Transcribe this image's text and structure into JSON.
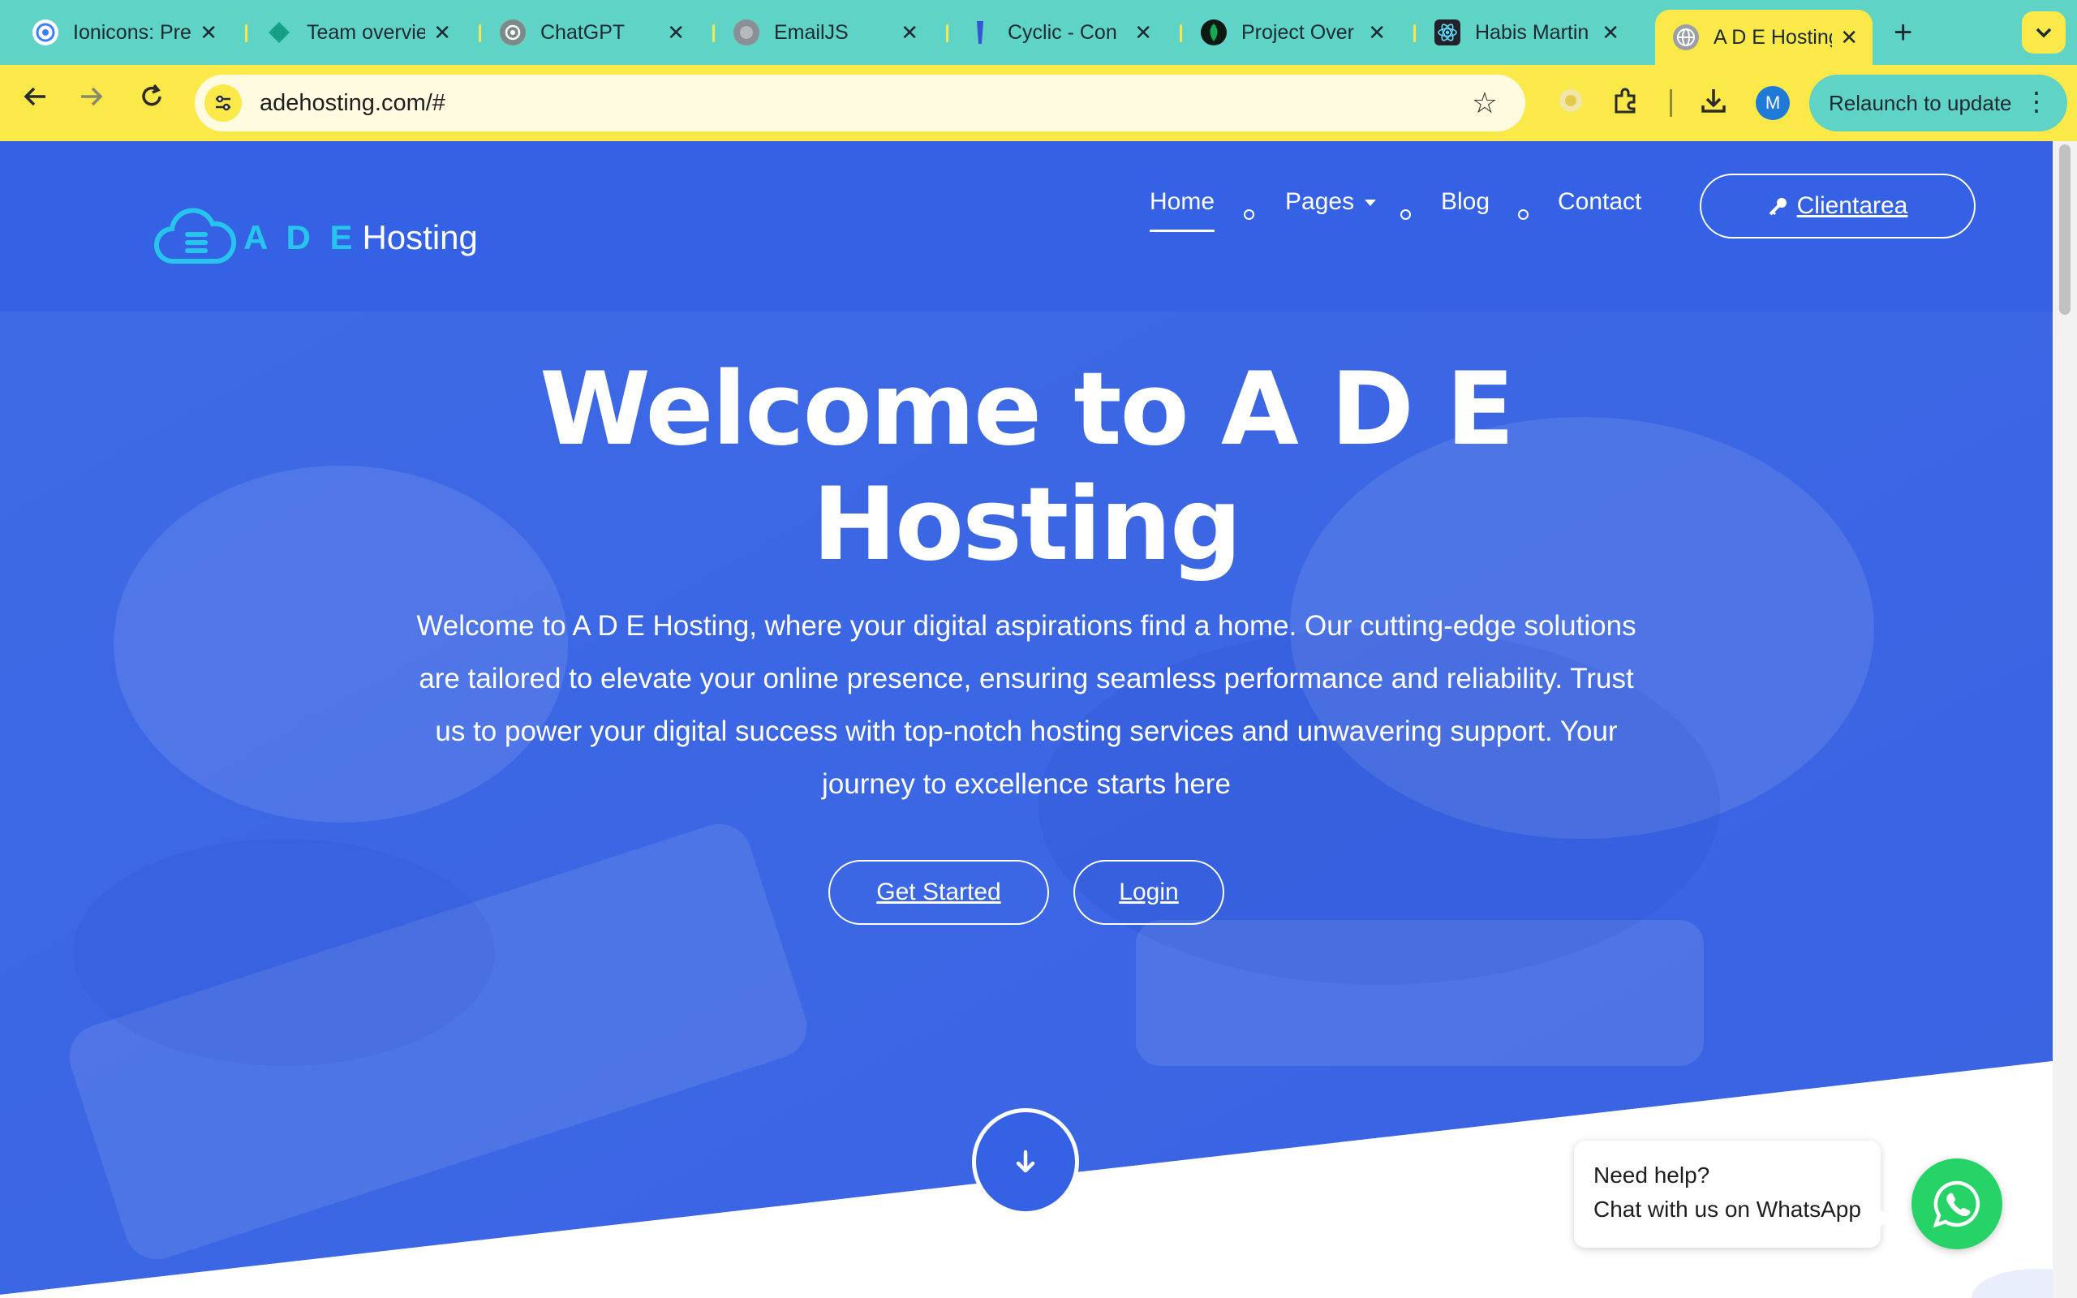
{
  "browser": {
    "tabs": [
      {
        "title": "Ionicons: Pre",
        "icon": "ionicons-icon"
      },
      {
        "title": "Team overvie",
        "icon": "diamond-icon"
      },
      {
        "title": "ChatGPT",
        "icon": "chatgpt-icon"
      },
      {
        "title": "EmailJS",
        "icon": "emailjs-icon"
      },
      {
        "title": "Cyclic - Con",
        "icon": "cyclic-icon"
      },
      {
        "title": "Project Over",
        "icon": "mongodb-leaf-icon"
      },
      {
        "title": "Habis Martin",
        "icon": "react-atom-icon"
      },
      {
        "title": "A D E Hosting",
        "icon": "globe-icon",
        "active": true
      }
    ],
    "close_glyph": "✕",
    "new_tab": "+",
    "url": "adehosting.com/#",
    "profile_initial": "M",
    "relaunch_label": "Relaunch to update",
    "colors": {
      "tabbar": "#5fd3c5",
      "toolbar": "#fbe94a"
    }
  },
  "site": {
    "logo": {
      "ade": "A D E",
      "hosting": "Hosting"
    },
    "nav": {
      "home": "Home",
      "pages": "Pages",
      "blog": "Blog",
      "contact": "Contact"
    },
    "client_button": "Clientarea",
    "hero": {
      "title_line1": "Welcome to A D E",
      "title_line2": "Hosting",
      "text": "Welcome to A D E Hosting, where your digital aspirations find a home. Our cutting-edge solutions are tailored to elevate your online presence, ensuring seamless performance and reliability. Trust us to power your digital success with top-notch hosting services and unwavering support. Your journey to excellence starts here",
      "get_started": "Get Started",
      "login": "Login"
    },
    "whatsapp": {
      "line1": "Need help?",
      "line2": "Chat with us on WhatsApp"
    },
    "colors": {
      "primary": "#3561e4",
      "accent": "#27c5ee",
      "whatsapp": "#25d366"
    }
  }
}
